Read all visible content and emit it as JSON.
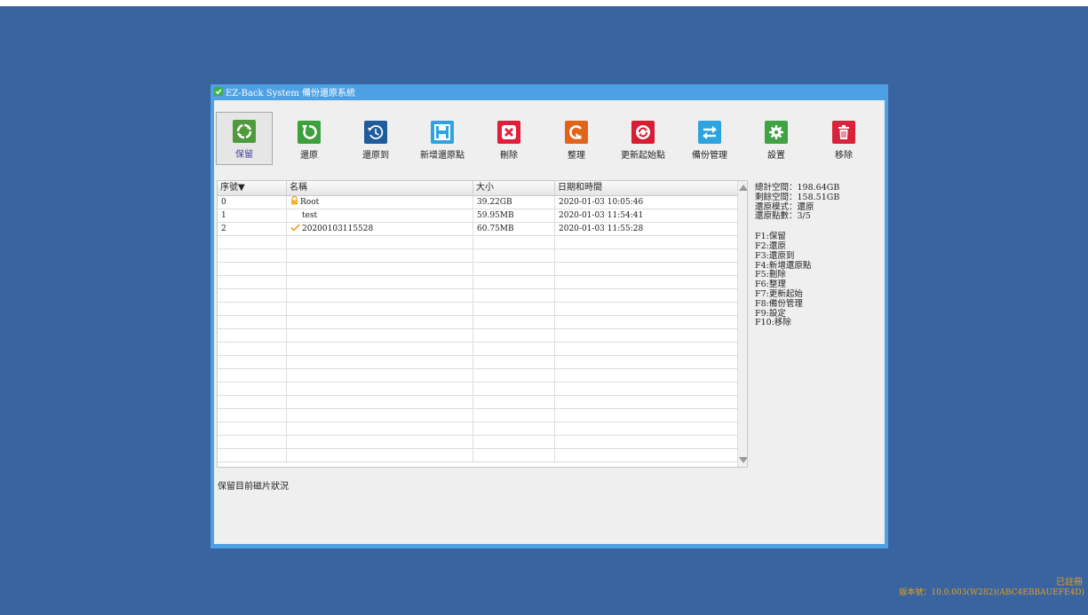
{
  "window": {
    "title": "EZ-Back System 備份還原系統"
  },
  "toolbar": [
    {
      "label": "保留",
      "icon": "refresh-circle-icon",
      "color": "#4f9a3c",
      "selected": true
    },
    {
      "label": "還原",
      "icon": "restore-icon",
      "color": "#3ca03c"
    },
    {
      "label": "還原到",
      "icon": "history-clock-icon",
      "color": "#1f5c9c"
    },
    {
      "label": "新增還原點",
      "icon": "floppy-disk-icon",
      "color": "#2fa3df"
    },
    {
      "label": "刪除",
      "icon": "close-x-icon",
      "color": "#e0203a"
    },
    {
      "label": "整理",
      "icon": "broom-icon",
      "color": "#e0641c"
    },
    {
      "label": "更新起始點",
      "icon": "update-cycle-icon",
      "color": "#d81c34"
    },
    {
      "label": "備份管理",
      "icon": "swap-arrows-icon",
      "color": "#2fa3df"
    },
    {
      "label": "設置",
      "icon": "gear-icon",
      "color": "#3fa344"
    },
    {
      "label": "移除",
      "icon": "trash-icon",
      "color": "#d8233a"
    }
  ],
  "table": {
    "columns": [
      "序號▼",
      "名稱",
      "大小",
      "日期和時間"
    ],
    "rows": [
      {
        "index": "0",
        "name": "Root",
        "icon": "lock-icon",
        "size": "39.22GB",
        "datetime": "2020-01-03 10:05:46"
      },
      {
        "index": "1",
        "name": "test",
        "icon": "",
        "size": "59.95MB",
        "datetime": "2020-01-03 11:54:41"
      },
      {
        "index": "2",
        "name": "20200103115528",
        "icon": "check-mark-icon",
        "size": "60.75MB",
        "datetime": "2020-01-03 11:55:28"
      }
    ],
    "empty_rows": 17
  },
  "info": {
    "stats": [
      "總計空間：198.64GB",
      "剩餘空間：158.51GB",
      "還原模式：還原",
      "還原點數：3/5"
    ],
    "shortcuts": [
      "F1:保留",
      "F2:還原",
      "F3:還原到",
      "F4:新增還原點",
      "F5:刪除",
      "F6:整理",
      "F7:更新起始",
      "F8:備份管理",
      "F9:設定",
      "F10:移除"
    ]
  },
  "status": {
    "description": "保留目前磁片狀況"
  },
  "footer": {
    "registered": "已註冊",
    "version": "版本號：10.0.003(W282)(ABC4EBBAUEFE4D)"
  },
  "colors": {
    "desktop": "#3a64a0",
    "window_border": "#4da0e3",
    "client_bg": "#efefef",
    "footer_text": "#e0a020"
  }
}
